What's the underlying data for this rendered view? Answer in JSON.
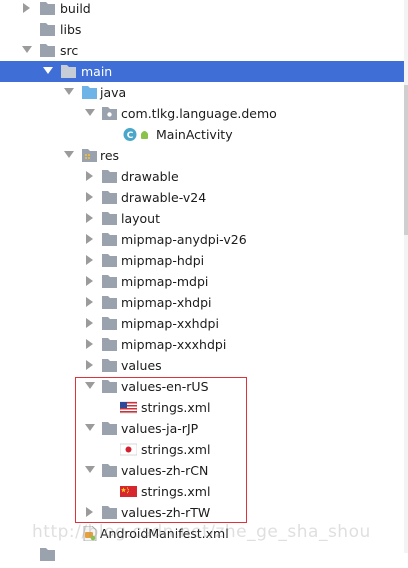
{
  "tree": {
    "items": [
      {
        "label": "build",
        "kind": "folder"
      },
      {
        "label": "libs",
        "kind": "folder"
      },
      {
        "label": "src",
        "kind": "folder"
      },
      {
        "label": "main",
        "kind": "folder"
      },
      {
        "label": "java",
        "kind": "source-folder"
      },
      {
        "label": "com.tlkg.language.demo",
        "kind": "package"
      },
      {
        "label": "MainActivity",
        "kind": "class"
      },
      {
        "label": "res",
        "kind": "res-folder"
      },
      {
        "label": "drawable",
        "kind": "folder"
      },
      {
        "label": "drawable-v24",
        "kind": "folder"
      },
      {
        "label": "layout",
        "kind": "folder"
      },
      {
        "label": "mipmap-anydpi-v26",
        "kind": "folder"
      },
      {
        "label": "mipmap-hdpi",
        "kind": "folder"
      },
      {
        "label": "mipmap-mdpi",
        "kind": "folder"
      },
      {
        "label": "mipmap-xhdpi",
        "kind": "folder"
      },
      {
        "label": "mipmap-xxhdpi",
        "kind": "folder"
      },
      {
        "label": "mipmap-xxxhdpi",
        "kind": "folder"
      },
      {
        "label": "values",
        "kind": "folder"
      },
      {
        "label": "values-en-rUS",
        "kind": "folder"
      },
      {
        "label": "strings.xml",
        "kind": "flag-us"
      },
      {
        "label": "values-ja-rJP",
        "kind": "folder"
      },
      {
        "label": "strings.xml",
        "kind": "flag-jp"
      },
      {
        "label": "values-zh-rCN",
        "kind": "folder"
      },
      {
        "label": "strings.xml",
        "kind": "flag-cn"
      },
      {
        "label": "values-zh-rTW",
        "kind": "folder"
      },
      {
        "label": "AndroidManifest.xml",
        "kind": "manifest"
      }
    ]
  },
  "watermark": {
    "text": "http://blog.csdn.net/zhe_ge_sha_shou"
  },
  "colors": {
    "selection": "#3f6ed6",
    "folder": "#9aa3ad",
    "source_folder": "#6fb4e6",
    "highlight": "#e0323a"
  }
}
